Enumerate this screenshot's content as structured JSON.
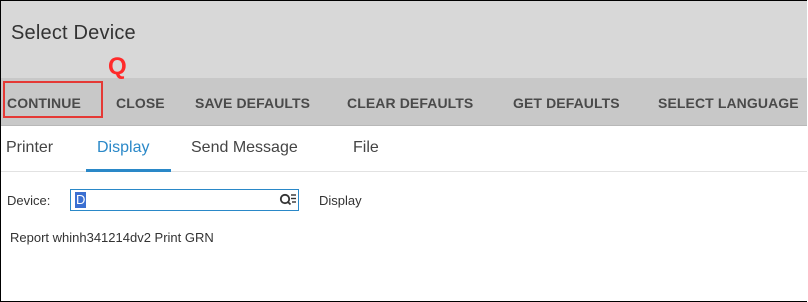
{
  "window": {
    "title": "Select Device"
  },
  "toolbar": {
    "buttons": [
      {
        "label": "CONTINUE"
      },
      {
        "label": "CLOSE"
      },
      {
        "label": "SAVE DEFAULTS"
      },
      {
        "label": "CLEAR DEFAULTS"
      },
      {
        "label": "GET DEFAULTS"
      },
      {
        "label": "SELECT LANGUAGE"
      }
    ],
    "hotkey_hint": "Q",
    "highlight_color": "#e53935"
  },
  "tabs": [
    {
      "label": "Printer",
      "active": false
    },
    {
      "label": "Display",
      "active": true
    },
    {
      "label": "Send Message",
      "active": false
    },
    {
      "label": "File",
      "active": false
    }
  ],
  "form": {
    "device_label": "Device:",
    "device_value": "D",
    "device_description": "Display",
    "lookup_icon": "search-list-icon"
  },
  "report": {
    "text": "Report whinh341214dv2 Print GRN"
  },
  "colors": {
    "accent": "#2a88c8",
    "toolbar_bg": "#c8c8c8",
    "title_bg": "#d8d8d8"
  }
}
